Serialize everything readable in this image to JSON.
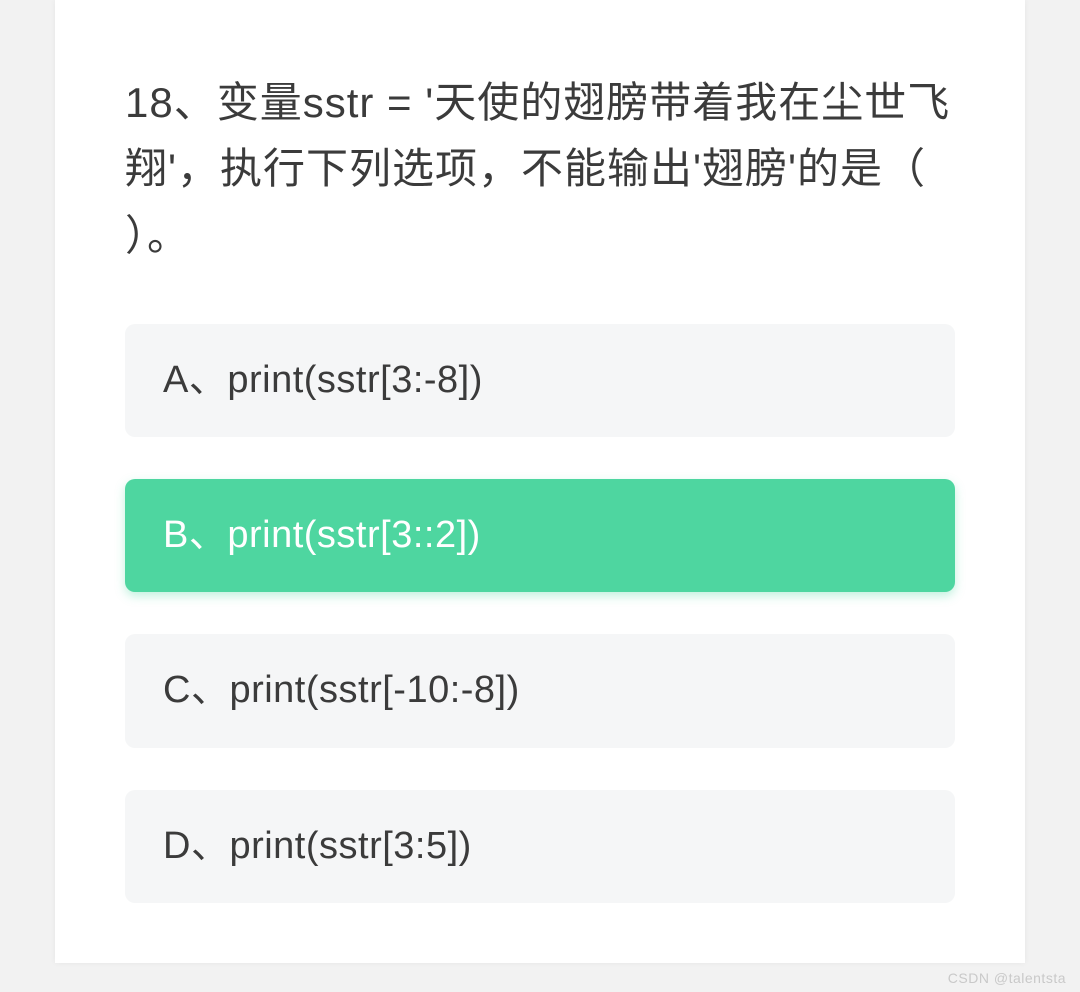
{
  "question": {
    "number": "18",
    "text": "18、变量sstr = '天使的翅膀带着我在尘世飞翔'，执行下列选项，不能输出'翅膀'的是（ ）。"
  },
  "options": [
    {
      "letter": "A",
      "label": "A、print(sstr[3:-8])",
      "selected": false
    },
    {
      "letter": "B",
      "label": "B、print(sstr[3::2])",
      "selected": true
    },
    {
      "letter": "C",
      "label": "C、print(sstr[-10:-8])",
      "selected": false
    },
    {
      "letter": "D",
      "label": "D、print(sstr[3:5])",
      "selected": false
    }
  ],
  "watermark": "CSDN @talentsta"
}
